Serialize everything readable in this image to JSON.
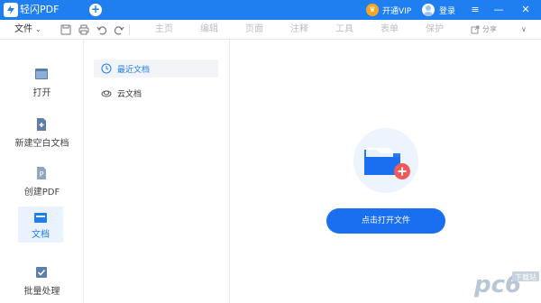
{
  "app": {
    "title": "轻闪PDF"
  },
  "titlebar": {
    "vip_label": "开通VIP",
    "login_label": "登录",
    "controls": {
      "menu": "≡",
      "minimize": "—",
      "close": "✕"
    }
  },
  "toolbar": {
    "file_menu": "文件",
    "nav": [
      "主页",
      "编辑",
      "页面",
      "注释",
      "工具",
      "表单",
      "保护"
    ],
    "share": "分享",
    "more": "∨",
    "icons": [
      "save-icon",
      "print-icon",
      "undo-icon",
      "redo-icon"
    ]
  },
  "sidebar": {
    "items": [
      {
        "label": "打开",
        "icon": "folder-open-icon"
      },
      {
        "label": "新建空白文档",
        "icon": "new-document-icon"
      },
      {
        "label": "创建PDF",
        "icon": "create-pdf-icon"
      },
      {
        "label": "文档",
        "icon": "document-icon",
        "active": true
      },
      {
        "label": "批量处理",
        "icon": "batch-icon"
      }
    ]
  },
  "midpanel": {
    "items": [
      {
        "label": "最近文档",
        "icon": "clock-icon",
        "active": true
      },
      {
        "label": "云文档",
        "icon": "cloud-icon"
      }
    ]
  },
  "main": {
    "open_button": "点击打开文件"
  },
  "watermark": {
    "text": "pc6",
    "sub": "下载站"
  },
  "colors": {
    "accent": "#1f7ff0",
    "button": "#1a6ff0",
    "add_badge": "#f25a5a"
  }
}
